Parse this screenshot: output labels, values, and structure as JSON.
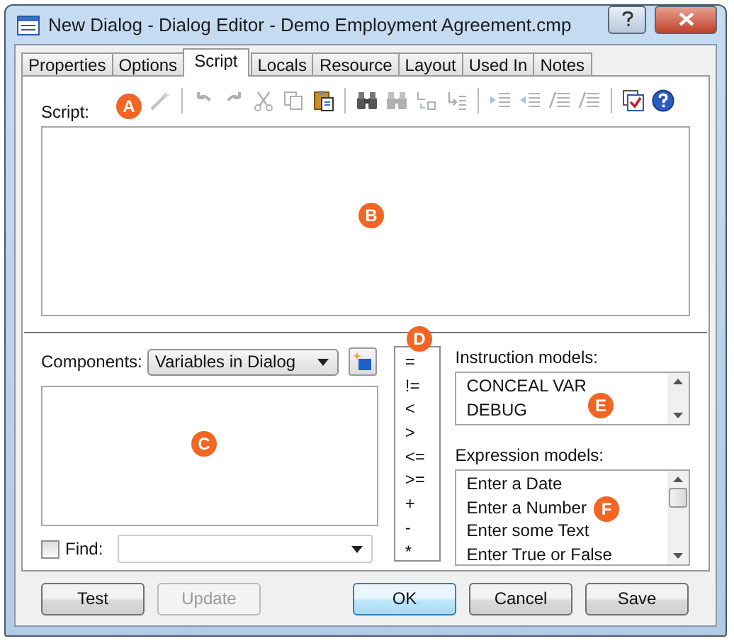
{
  "window": {
    "title": "New Dialog - Dialog Editor - Demo Employment Agreement.cmp"
  },
  "tabs": [
    {
      "label": "Properties",
      "selected": false
    },
    {
      "label": "Options",
      "selected": false
    },
    {
      "label": "Script",
      "selected": true
    },
    {
      "label": "Locals",
      "selected": false
    },
    {
      "label": "Resource",
      "selected": false
    },
    {
      "label": "Layout",
      "selected": false
    },
    {
      "label": "Used In",
      "selected": false
    },
    {
      "label": "Notes",
      "selected": false
    }
  ],
  "script_label": "Script:",
  "toolbar": [
    {
      "kind": "wand",
      "disabled": true
    },
    {
      "kind": "sep"
    },
    {
      "kind": "undo",
      "disabled": true
    },
    {
      "kind": "redo",
      "disabled": true
    },
    {
      "kind": "cut",
      "disabled": true
    },
    {
      "kind": "copy",
      "disabled": true
    },
    {
      "kind": "paste",
      "disabled": false
    },
    {
      "kind": "sep"
    },
    {
      "kind": "find",
      "disabled": false
    },
    {
      "kind": "findnext",
      "disabled": true
    },
    {
      "kind": "replace",
      "disabled": true
    },
    {
      "kind": "goto",
      "disabled": true
    },
    {
      "kind": "sep"
    },
    {
      "kind": "indent",
      "disabled": true
    },
    {
      "kind": "outdent",
      "disabled": true
    },
    {
      "kind": "comment",
      "disabled": true
    },
    {
      "kind": "uncomment",
      "disabled": true
    },
    {
      "kind": "sep"
    },
    {
      "kind": "check",
      "disabled": false
    },
    {
      "kind": "help",
      "disabled": false
    }
  ],
  "components": {
    "label": "Components:",
    "value": "Variables in Dialog"
  },
  "find": {
    "label": "Find:",
    "checked": false
  },
  "operators": [
    "=",
    "!=",
    "<",
    ">",
    "<=",
    ">=",
    "+",
    "-",
    "*"
  ],
  "instruction_models": {
    "label": "Instruction models:",
    "items": [
      "CONCEAL VAR",
      "DEBUG"
    ]
  },
  "expression_models": {
    "label": "Expression models:",
    "items": [
      "Enter a Date",
      "Enter a Number",
      "Enter some Text",
      "Enter True or False"
    ]
  },
  "buttons": [
    {
      "label": "Test",
      "disabled": false,
      "default": false
    },
    {
      "label": "Update",
      "disabled": true,
      "default": false
    },
    {
      "label": "OK",
      "disabled": false,
      "default": true
    },
    {
      "label": "Cancel",
      "disabled": false,
      "default": false
    },
    {
      "label": "Save",
      "disabled": false,
      "default": false
    }
  ],
  "callouts": [
    "A",
    "B",
    "C",
    "D",
    "E",
    "F"
  ]
}
